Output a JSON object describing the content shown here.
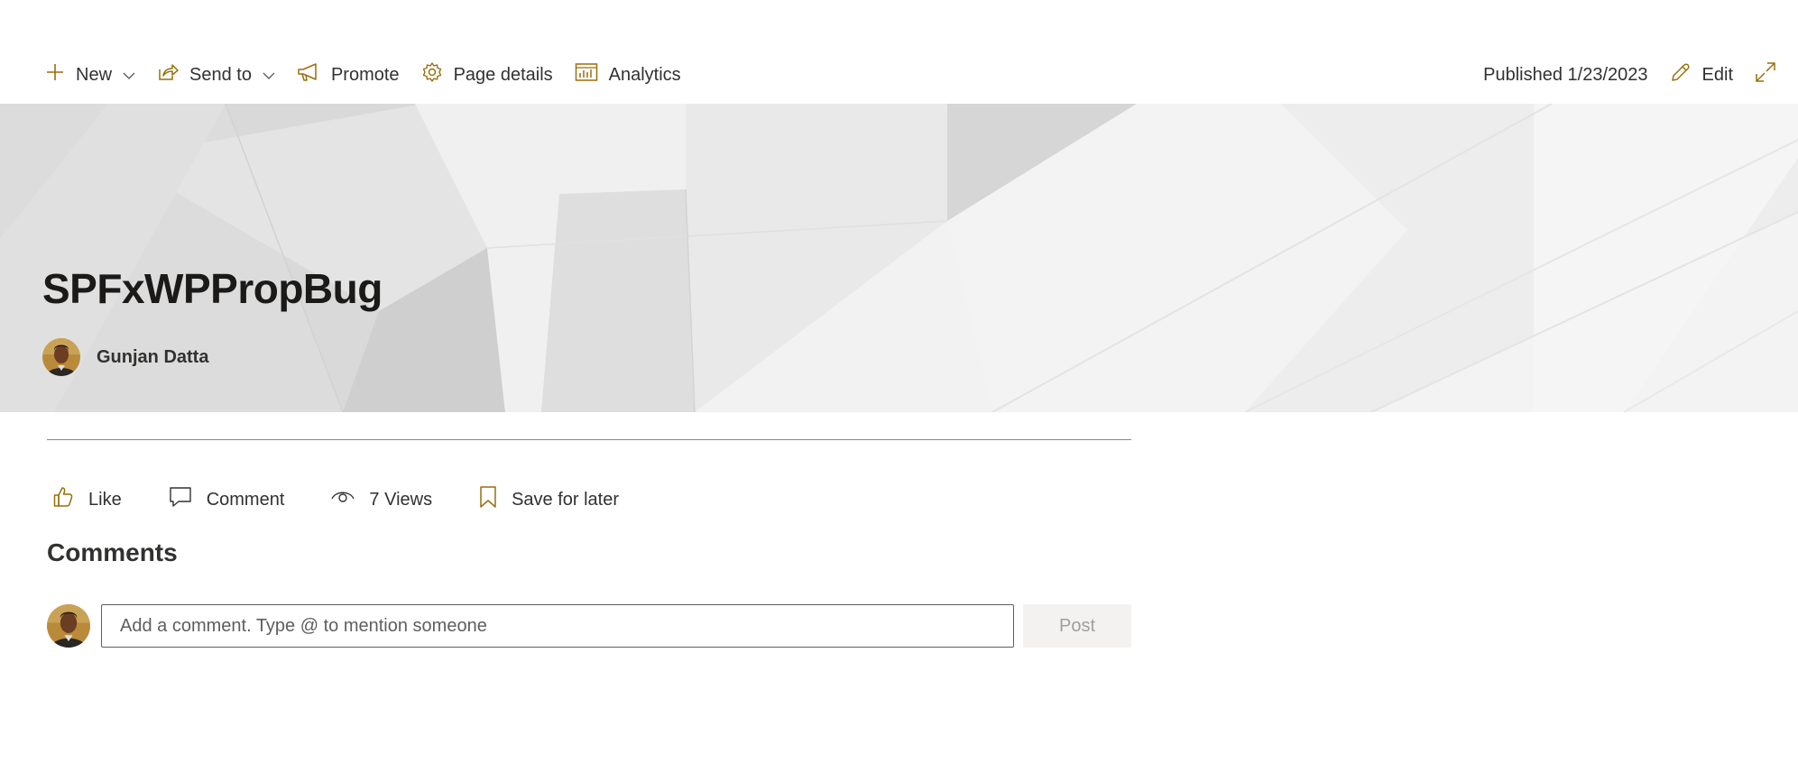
{
  "commandbar": {
    "new_label": "New",
    "send_to_label": "Send to",
    "promote_label": "Promote",
    "page_details_label": "Page details",
    "analytics_label": "Analytics",
    "published_text": "Published 1/23/2023",
    "edit_label": "Edit",
    "icons": [
      "add-icon",
      "chevron-down-icon",
      "share-icon",
      "megaphone-icon",
      "gear-icon",
      "analytics-icon",
      "pencil-icon",
      "expand-icon"
    ]
  },
  "page": {
    "title": "SPFxWPPropBug",
    "author": "Gunjan Datta"
  },
  "social": {
    "like_label": "Like",
    "comment_label": "Comment",
    "views_label": "7 Views",
    "save_label": "Save for later"
  },
  "comments": {
    "heading": "Comments",
    "placeholder": "Add a comment. Type @ to mention someone",
    "post_label": "Post"
  },
  "colors": {
    "accent": "#986f0b",
    "text": "#323130",
    "title": "#1b1a19",
    "post_disabled_bg": "#f3f2f1",
    "post_disabled_text": "#a19f9d"
  }
}
